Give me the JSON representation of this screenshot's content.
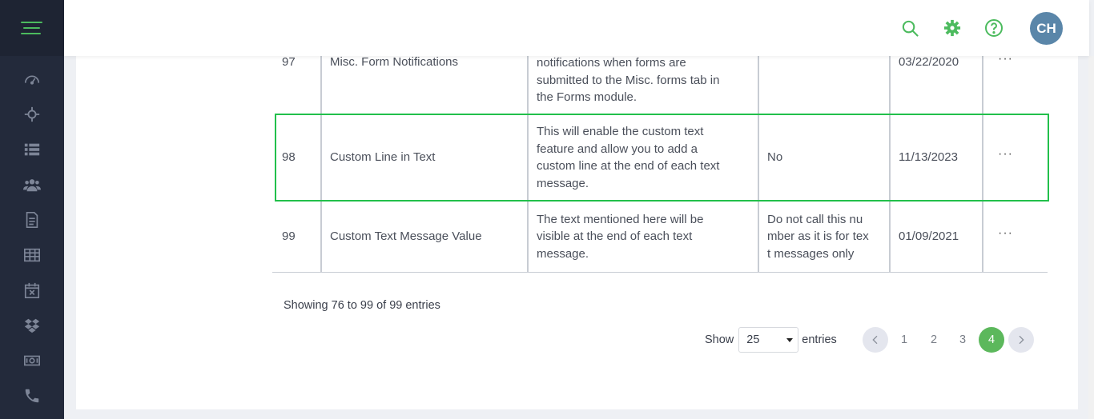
{
  "header": {
    "avatar_initials": "CH",
    "icons": [
      "search-icon",
      "gear-icon",
      "help-icon"
    ],
    "accent": "#4cbb5e"
  },
  "sidebar": {
    "icons": [
      "dashboard-icon",
      "crosshair-icon",
      "list-icon",
      "users-icon",
      "document-icon",
      "table-icon",
      "calendar-x-icon",
      "dropbox-icon",
      "money-icon",
      "phone-icon"
    ]
  },
  "table": {
    "rows": [
      {
        "no": "97",
        "name": "Misc. Form Notifications",
        "desc_lines": [
          "notifications when forms are",
          "submitted to the Misc. forms tab in",
          "the Forms module."
        ],
        "value_lines": [],
        "date": "03/22/2020",
        "actions": "···"
      },
      {
        "no": "98",
        "name": "Custom Line in Text",
        "desc_lines": [
          "This will enable the custom text",
          "feature and allow you to add a",
          "custom line at the end of each text",
          "message."
        ],
        "value_lines": [
          "No"
        ],
        "date": "11/13/2023",
        "actions": "···"
      },
      {
        "no": "99",
        "name": "Custom Text Message Value",
        "desc_lines": [
          "The text mentioned here will be",
          "visible at the end of each text",
          "message."
        ],
        "value_lines": [
          "Do not call this nu",
          "mber as it is for tex",
          "t messages only"
        ],
        "date": "01/09/2021",
        "actions": "···"
      }
    ],
    "highlight_color": "#22c04b"
  },
  "footer": {
    "showing": "Showing 76 to 99 of 99 entries",
    "show_label": "Show",
    "page_size": "25",
    "entries_label": "entries",
    "pages": [
      "1",
      "2",
      "3",
      "4"
    ],
    "current_page": "4"
  }
}
